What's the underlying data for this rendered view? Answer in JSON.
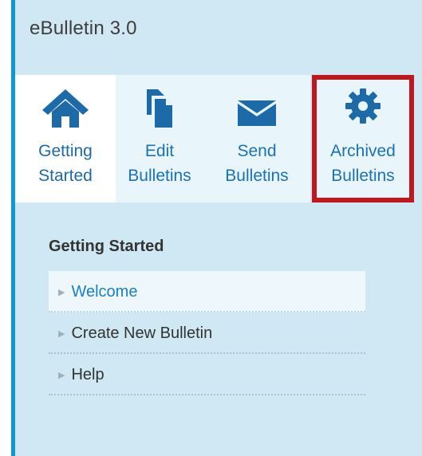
{
  "app": {
    "title": "eBulletin 3.0"
  },
  "tabs": [
    {
      "line1": "Getting",
      "line2": "Started",
      "icon": "home-icon"
    },
    {
      "line1": "Edit",
      "line2": "Bulletins",
      "icon": "documents-icon"
    },
    {
      "line1": "Send",
      "line2": "Bulletins",
      "icon": "envelope-icon"
    },
    {
      "line1": "Archived",
      "line2": "Bulletins",
      "icon": "gear-icon"
    }
  ],
  "section": {
    "title": "Getting Started",
    "items": [
      {
        "label": "Welcome",
        "active": true
      },
      {
        "label": "Create New Bulletin",
        "active": false
      },
      {
        "label": "Help",
        "active": false
      }
    ]
  },
  "colors": {
    "accent": "#0f9ad6",
    "panel_bg": "#cfe8f4",
    "link": "#1b72b5",
    "highlight_border": "#c0161d"
  }
}
